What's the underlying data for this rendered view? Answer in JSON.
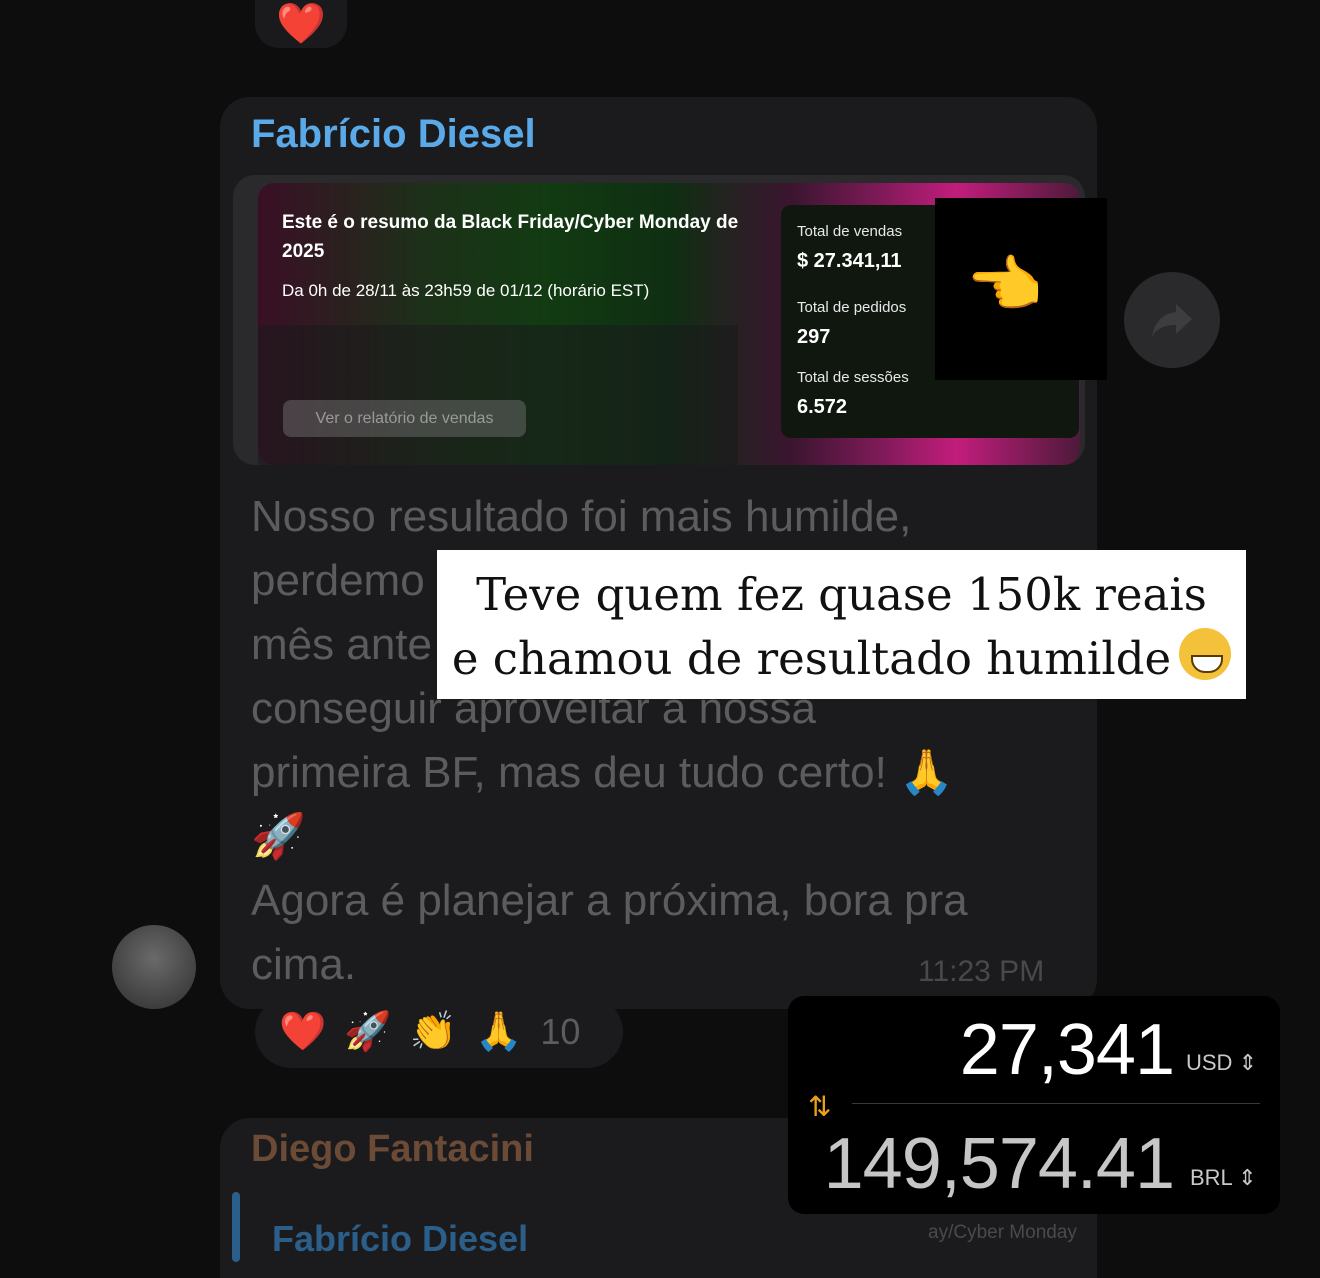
{
  "top_reaction": {
    "emoji": "❤️"
  },
  "message": {
    "sender": "Fabrício Diesel",
    "preview": {
      "title": "Este é o resumo da Black Friday/Cyber Monday de 2025",
      "subtitle": "Da 0h de 28/11 às 23h59 de 01/12 (horário EST)",
      "button_label": "Ver o relatório de vendas",
      "stats": [
        {
          "label": "Total de vendas",
          "value": "$ 27.341,11"
        },
        {
          "label": "Total de pedidos",
          "value": "297"
        },
        {
          "label": "Total de sessões",
          "value": "6.572"
        }
      ]
    },
    "text_lines": [
      "Nosso resultado foi mais humilde,",
      "perdemo",
      "mês ante",
      "conseguir aproveitar a nossa",
      "primeira BF, mas deu tudo certo! 🙏",
      "🚀",
      "Agora é planejar a próxima,  bora pra",
      "cima."
    ],
    "time": "11:23 PM"
  },
  "reactions": {
    "emojis": [
      "❤️",
      "🚀",
      "👏",
      "🙏"
    ],
    "count": "10"
  },
  "caption": {
    "line1": "Teve quem fez quase 150k reais",
    "line2": "e chamou de resultado humilde"
  },
  "next_message": {
    "sender": "Diego Fantacini",
    "quote_name": "Fabrício Diesel",
    "quote_snippet": "ay/Cyber Monday"
  },
  "converter": {
    "from_amount": "27,341",
    "from_currency": "USD",
    "to_amount": "149,574.41",
    "to_currency": "BRL"
  }
}
